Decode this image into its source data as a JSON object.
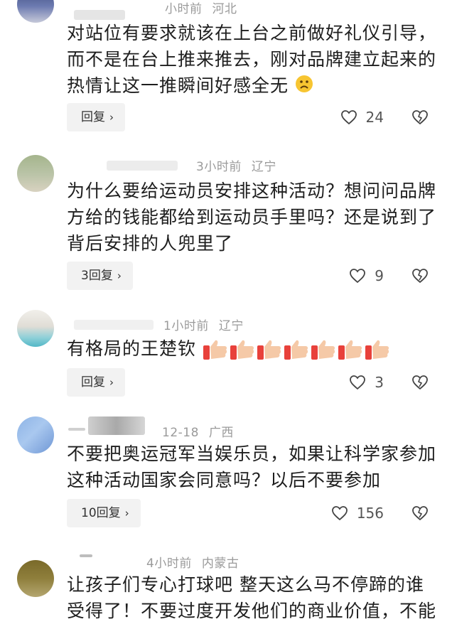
{
  "comments": [
    {
      "time": "小时前",
      "location": "河北",
      "text": "对站位有要求就该在上台之前做好礼仪引导，而不是在台上推来推去，刚对品牌建立起来的热情让这一推瞬间好感全无",
      "reply_label": "回复",
      "likes": "24"
    },
    {
      "time": "3小时前",
      "location": "辽宁",
      "text": "为什么要给运动员安排这种活动？想问问品牌方给的钱能都给到运动员手里吗？还是说到了背后安排的人兜里了",
      "reply_label": "3回复",
      "likes": "9"
    },
    {
      "time": "1小时前",
      "location": "辽宁",
      "text": "有格局的王楚钦",
      "reply_label": "回复",
      "likes": "3"
    },
    {
      "time": "12-18",
      "location": "广西",
      "text": "不要把奥运冠军当娱乐员，如果让科学家参加这种活动国家会同意吗？以后不要参加",
      "reply_label": "10回复",
      "likes": "156"
    },
    {
      "time": "4小时前",
      "location": "内蒙古",
      "text": "让孩子们专心打球吧 整天这么马不停蹄的谁受得了！不要过度开发他们的商业价值，不能",
      "reply_label": "",
      "likes": ""
    }
  ],
  "icons": {
    "like": "heart-outline-icon",
    "dislike": "broken-heart-icon",
    "chevron": "chevron-right-icon",
    "sad_emoji": "sad-face-emoji",
    "thumbs_up_emoji": "thumbs-up-emoji"
  },
  "colors": {
    "meta_text": "#9a9a9a",
    "reply_bg": "#f2f2f2",
    "emoji_yellow": "#f7c531",
    "thumb_red": "#e8413b"
  }
}
